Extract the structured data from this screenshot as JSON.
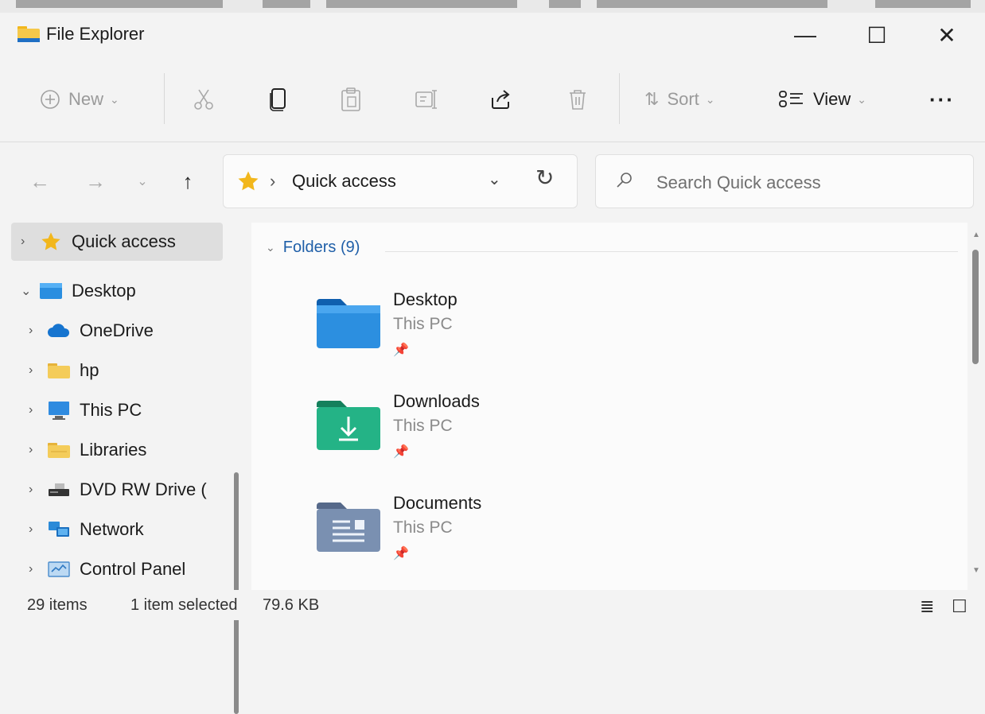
{
  "window": {
    "title": "File Explorer",
    "minimize": "—",
    "maximize": "☐",
    "close": "✕"
  },
  "commandbar": {
    "new_label": "New",
    "sort_label": "Sort",
    "view_label": "View",
    "more": "···"
  },
  "address": {
    "path": "Quick access",
    "search_placeholder": "Search Quick access"
  },
  "sidebar": {
    "items": [
      {
        "label": "Quick access",
        "icon": "star-icon"
      },
      {
        "label": "Desktop",
        "icon": "desktop-icon"
      },
      {
        "label": "OneDrive",
        "icon": "cloud-icon"
      },
      {
        "label": "hp",
        "icon": "folder-icon"
      },
      {
        "label": "This PC",
        "icon": "computer-icon"
      },
      {
        "label": "Libraries",
        "icon": "library-icon"
      },
      {
        "label": "DVD RW Drive (",
        "icon": "dvd-drive-icon"
      },
      {
        "label": "Network",
        "icon": "network-icon"
      },
      {
        "label": "Control Panel",
        "icon": "control-panel-icon"
      }
    ]
  },
  "main": {
    "group_title": "Folders (9)",
    "folders": [
      {
        "name": "Desktop",
        "location": "This PC",
        "color": "#1f7fd1"
      },
      {
        "name": "Downloads",
        "location": "This PC",
        "color": "#1faa7a"
      },
      {
        "name": "Documents",
        "location": "This PC",
        "color": "#6f86a6"
      }
    ]
  },
  "status": {
    "count": "29 items",
    "selection": "1 item selected",
    "size": "79.6 KB"
  },
  "colors": {
    "accent": "#1f5fa8",
    "star": "#f2b71c",
    "folder_yellow": "#f1c44b"
  }
}
